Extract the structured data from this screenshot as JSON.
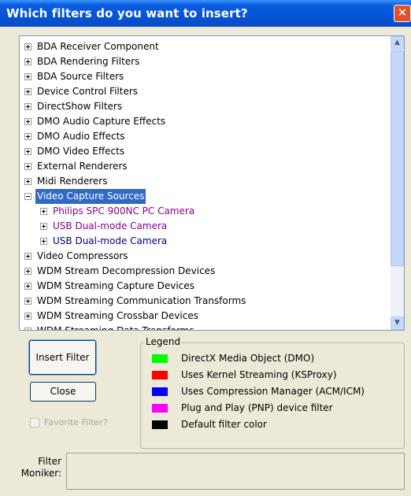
{
  "window": {
    "title": "Which filters do you want to insert?",
    "close_glyph": "✕"
  },
  "tree": {
    "items": [
      {
        "label": "BDA Receiver Component",
        "level": 0,
        "color": "#000000",
        "selected": false
      },
      {
        "label": "BDA Rendering Filters",
        "level": 0,
        "color": "#000000",
        "selected": false
      },
      {
        "label": "BDA Source Filters",
        "level": 0,
        "color": "#000000",
        "selected": false
      },
      {
        "label": "Device Control Filters",
        "level": 0,
        "color": "#000000",
        "selected": false
      },
      {
        "label": "DirectShow Filters",
        "level": 0,
        "color": "#000000",
        "selected": false
      },
      {
        "label": "DMO Audio Capture Effects",
        "level": 0,
        "color": "#000000",
        "selected": false
      },
      {
        "label": "DMO Audio Effects",
        "level": 0,
        "color": "#000000",
        "selected": false
      },
      {
        "label": "DMO Video Effects",
        "level": 0,
        "color": "#000000",
        "selected": false
      },
      {
        "label": "External Renderers",
        "level": 0,
        "color": "#000000",
        "selected": false
      },
      {
        "label": "Midi Renderers",
        "level": 0,
        "color": "#000000",
        "selected": false
      },
      {
        "label": "Video Capture Sources",
        "level": 0,
        "color": "#000000",
        "selected": true,
        "expanded": true
      },
      {
        "label": "Philips SPC 900NC PC Camera",
        "level": 1,
        "color": "#8b008b",
        "selected": false
      },
      {
        "label": "USB Dual-mode Camera",
        "level": 1,
        "color": "#8b008b",
        "selected": false
      },
      {
        "label": "USB Dual-mode Camera",
        "level": 1,
        "color": "#000080",
        "selected": false
      },
      {
        "label": "Video Compressors",
        "level": 0,
        "color": "#000000",
        "selected": false
      },
      {
        "label": "WDM Stream Decompression Devices",
        "level": 0,
        "color": "#000000",
        "selected": false
      },
      {
        "label": "WDM Streaming Capture Devices",
        "level": 0,
        "color": "#000000",
        "selected": false
      },
      {
        "label": "WDM Streaming Communication Transforms",
        "level": 0,
        "color": "#000000",
        "selected": false
      },
      {
        "label": "WDM Streaming Crossbar Devices",
        "level": 0,
        "color": "#000000",
        "selected": false
      },
      {
        "label": "WDM Streaming Data Transforms",
        "level": 0,
        "color": "#000000",
        "selected": false
      }
    ]
  },
  "buttons": {
    "insert_label": "Insert Filter",
    "close_label": "Close"
  },
  "favorite": {
    "label": "Favorite Filter?",
    "checked": false,
    "enabled": false
  },
  "legend": {
    "title": "Legend",
    "entries": [
      {
        "label": "DirectX Media Object (DMO)",
        "color": "#00ff00"
      },
      {
        "label": "Uses Kernel Streaming (KSProxy)",
        "color": "#ff0000"
      },
      {
        "label": "Uses Compression Manager (ACM/ICM)",
        "color": "#0000ff"
      },
      {
        "label": "Plug and Play (PNP) device filter",
        "color": "#ff00ff"
      },
      {
        "label": "Default filter color",
        "color": "#000000"
      }
    ]
  },
  "moniker": {
    "label_line1": "Filter",
    "label_line2": "Moniker:",
    "value": ""
  }
}
